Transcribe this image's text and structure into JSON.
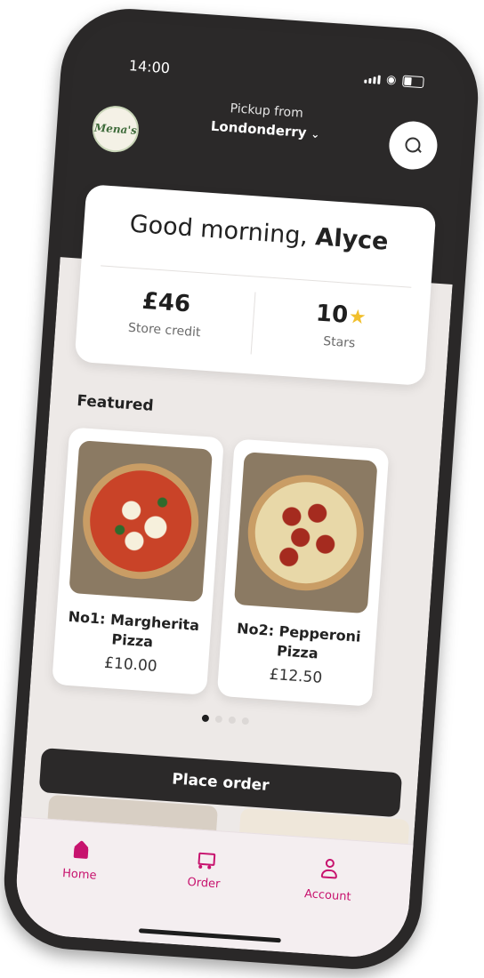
{
  "status_bar": {
    "time": "14:00"
  },
  "header": {
    "logo_text": "Mena's",
    "pickup_label": "Pickup from",
    "pickup_location": "Londonderry"
  },
  "greeting": {
    "prefix": "Good morning, ",
    "name": "Alyce"
  },
  "stats": {
    "credit_value": "£46",
    "credit_label": "Store credit",
    "stars_value": "10",
    "stars_label": "Stars"
  },
  "featured": {
    "heading": "Featured",
    "products": [
      {
        "name": "No1: Margherita Pizza",
        "price": "£10.00"
      },
      {
        "name": "No2: Pepperoni Pizza",
        "price": "£12.50"
      }
    ],
    "carousel_position": 1,
    "carousel_count": 4
  },
  "actions": {
    "place_order": "Place order"
  },
  "tab_bar": {
    "items": [
      {
        "label": "Home",
        "icon": "home-icon"
      },
      {
        "label": "Order",
        "icon": "cart-icon"
      },
      {
        "label": "Account",
        "icon": "person-icon"
      }
    ]
  },
  "colors": {
    "accent": "#c7136e",
    "dark": "#2b2929",
    "background": "#ede9e7",
    "star": "#f1bf2c"
  }
}
